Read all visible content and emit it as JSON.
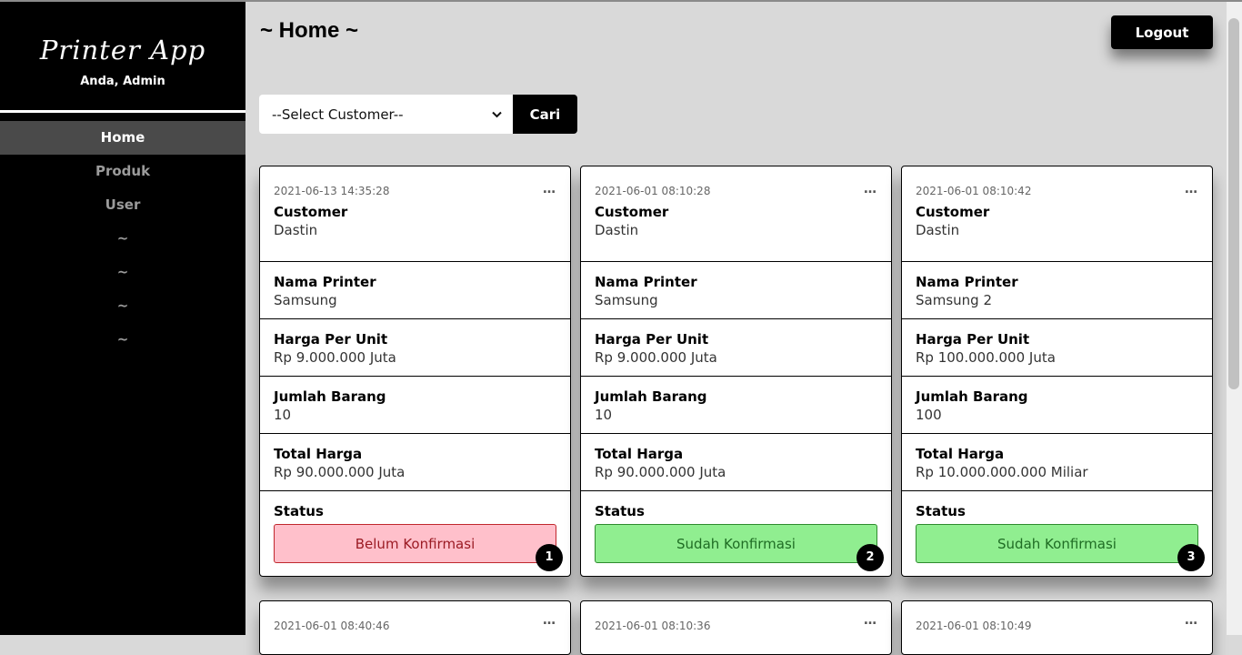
{
  "brand": {
    "title": "Printer App",
    "subtitle": "Anda, Admin"
  },
  "nav": [
    {
      "label": "Home",
      "active": true
    },
    {
      "label": "Produk",
      "active": false
    },
    {
      "label": "User",
      "active": false
    },
    {
      "label": "~",
      "active": false
    },
    {
      "label": "~",
      "active": false
    },
    {
      "label": "~",
      "active": false
    },
    {
      "label": "~",
      "active": false
    }
  ],
  "header": {
    "title": "~ Home ~",
    "logout_label": "Logout"
  },
  "search": {
    "selected": "--Select Customer--",
    "button_label": "Cari"
  },
  "fields": {
    "customer": "Customer",
    "printer": "Nama Printer",
    "price": "Harga Per Unit",
    "qty": "Jumlah Barang",
    "total": "Total Harga",
    "status": "Status"
  },
  "more_icon": "…",
  "cards": [
    {
      "date": "2021-06-13 14:35:28",
      "customer": "Dastin",
      "printer": "Samsung",
      "price": "Rp 9.000.000 Juta",
      "qty": "10",
      "total": "Rp 90.000.000 Juta",
      "status": "Belum Konfirmasi",
      "status_type": "pending",
      "number": "1"
    },
    {
      "date": "2021-06-01 08:10:28",
      "customer": "Dastin",
      "printer": "Samsung",
      "price": "Rp 9.000.000 Juta",
      "qty": "10",
      "total": "Rp 90.000.000 Juta",
      "status": "Sudah Konfirmasi",
      "status_type": "done",
      "number": "2"
    },
    {
      "date": "2021-06-01 08:10:42",
      "customer": "Dastin",
      "printer": "Samsung 2",
      "price": "Rp 100.000.000 Juta",
      "qty": "100",
      "total": "Rp 10.000.000.000 Miliar",
      "status": "Sudah Konfirmasi",
      "status_type": "done",
      "number": "3"
    },
    {
      "date": "2021-06-01 08:40:46"
    },
    {
      "date": "2021-06-01 08:10:36"
    },
    {
      "date": "2021-06-01 08:10:49"
    }
  ],
  "colors": {
    "sidebar_bg": "#000000",
    "page_bg": "#d9d9d9",
    "pending_bg": "#ffc0cb",
    "done_bg": "#90ee90"
  }
}
